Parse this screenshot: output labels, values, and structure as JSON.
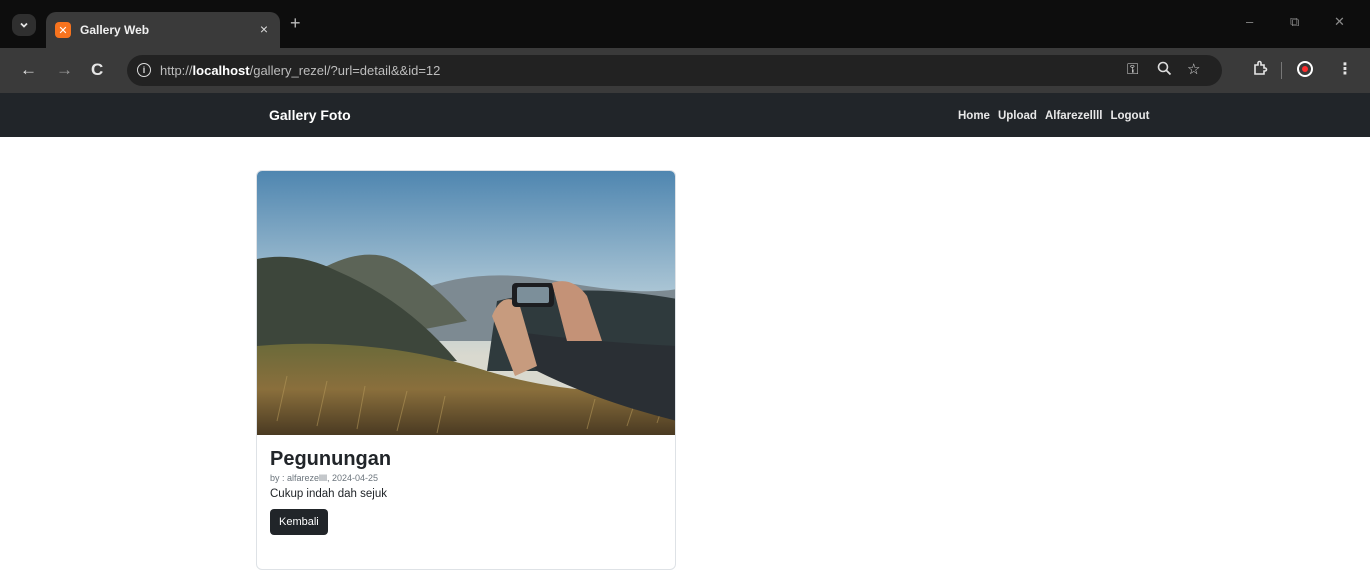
{
  "browser": {
    "tab_title": "Gallery Web",
    "tab_close": "×",
    "new_tab": "+",
    "url_scheme": "http://",
    "url_host": "localhost",
    "url_path": "/gallery_rezel/?url=detail&&id=12",
    "window_controls": {
      "minimize": "–",
      "restore": "⧉",
      "close": "✕"
    }
  },
  "navbar": {
    "brand": "Gallery Foto",
    "links": [
      "Home",
      "Upload",
      "Alfarezellll",
      "Logout"
    ]
  },
  "photo": {
    "title": "Pegunungan",
    "meta": "by : alfarezellll, 2024-04-25",
    "description": "Cukup indah dah sejuk",
    "back_button": "Kembali"
  },
  "colors": {
    "navbar_bg": "#212529",
    "button_bg": "#212529",
    "browser_frame": "#0d0d0d",
    "toolbar_bg": "#3a3a3a"
  }
}
